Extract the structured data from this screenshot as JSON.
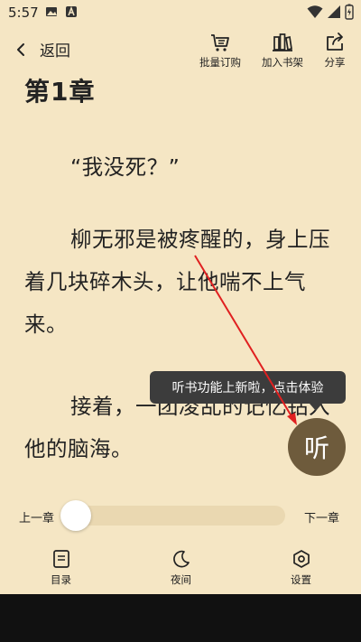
{
  "status_bar": {
    "time": "5:57"
  },
  "toolbar": {
    "back_label": "返回",
    "batch_order_label": "批量订购",
    "add_to_shelf_label": "加入书架",
    "share_label": "分享"
  },
  "content": {
    "chapter_title": "第1章",
    "paragraphs": [
      "“我没死？”",
      "柳无邪是被疼醒的，身上压着几块碎木头，让他喘不上气来。",
      "接着，一团凌乱的记忆钻入他的脑海。"
    ]
  },
  "tooltip": {
    "text": "听书功能上新啦，点击体验"
  },
  "listen_button": {
    "label": "听"
  },
  "progress": {
    "prev_label": "上一章",
    "next_label": "下一章",
    "fraction": 0.0
  },
  "bottom_bar": {
    "toc_label": "目录",
    "night_label": "夜间",
    "settings_label": "设置"
  },
  "colors": {
    "background": "#f5e6c4",
    "accent": "#6e5b3c",
    "annotation_arrow": "#e02020"
  }
}
